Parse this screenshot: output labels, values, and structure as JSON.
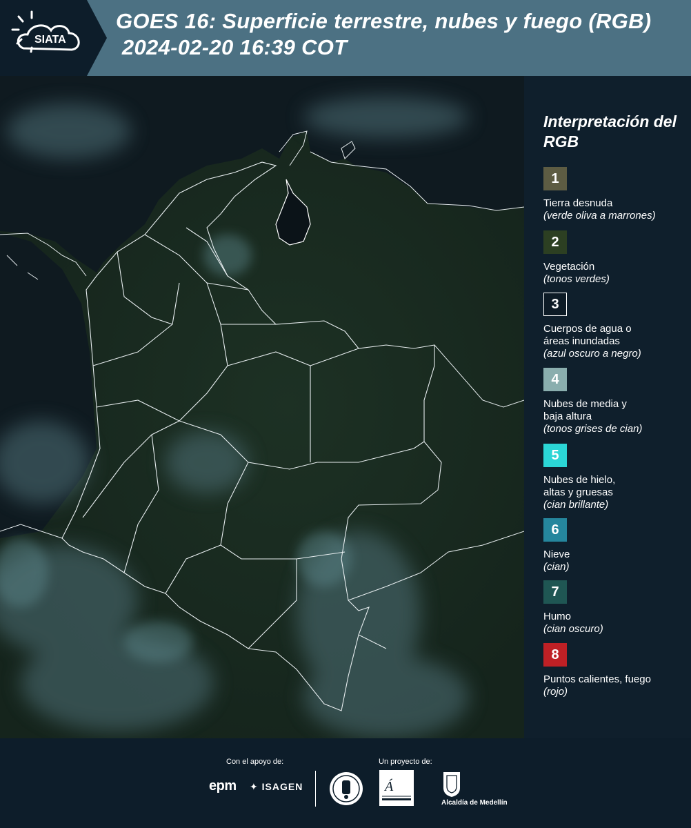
{
  "header": {
    "logo_text": "SIATA",
    "title_line1": "GOES 16: Superficie terrestre, nubes y fuego (RGB)",
    "title_line2": " 2024-02-20 16:39 COT"
  },
  "legend": {
    "title": "Interpretación del RGB",
    "items": [
      {
        "number": "1",
        "label": "Tierra desnuda",
        "hint": "(verde oliva a marrones)",
        "color": "#5d5c43"
      },
      {
        "number": "2",
        "label": "Vegetación",
        "hint": "(tonos verdes)",
        "color": "#2c3f22"
      },
      {
        "number": "3",
        "label": "Cuerpos de agua o áreas inundadas",
        "hint": "(azul oscuro a negro)",
        "color": "#0d1b26"
      },
      {
        "number": "4",
        "label": "Nubes de media y baja altura",
        "hint": "(tonos grises de cian)",
        "color": "#8aaeae"
      },
      {
        "number": "5",
        "label": "Nubes de hielo, altas y gruesas",
        "hint": "(cian brillante)",
        "color": "#2bd6d6"
      },
      {
        "number": "6",
        "label": "Nieve",
        "hint": "(cian)",
        "color": "#25869d"
      },
      {
        "number": "7",
        "label": "Humo",
        "hint": "(cian oscuro)",
        "color": "#1f5653"
      },
      {
        "number": "8",
        "label": "Puntos calientes, fuego",
        "hint": "(rojo)",
        "color": "#bf2025"
      }
    ]
  },
  "footer": {
    "support_label": "Con el apoyo de:",
    "project_label": "Un proyecto de:",
    "sponsors": [
      "epm",
      "ISAGEN"
    ],
    "project_partners": [
      "Área Metropolitana Valle de Aburrá",
      "Alcaldía de Medellín"
    ]
  }
}
